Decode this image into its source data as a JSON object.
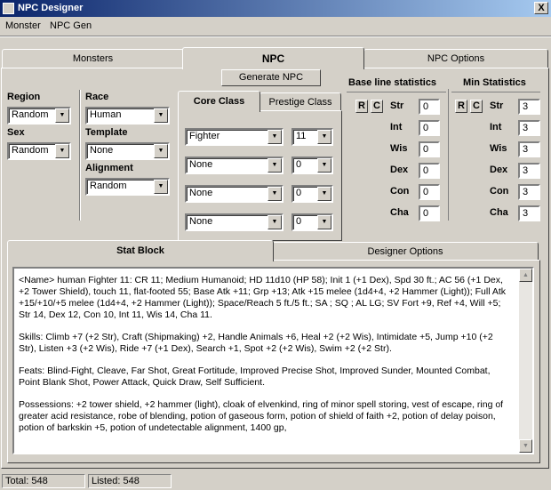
{
  "window": {
    "title": "NPC Designer",
    "close": "X"
  },
  "menu": [
    "Monster",
    "NPC Gen"
  ],
  "main_tabs": [
    "Monsters",
    "NPC",
    "NPC Options"
  ],
  "generate_button": "Generate NPC",
  "left": {
    "region_label": "Region",
    "region_value": "Random",
    "sex_label": "Sex",
    "sex_value": "Random",
    "race_label": "Race",
    "race_value": "Human",
    "template_label": "Template",
    "template_value": "None",
    "alignment_label": "Alignment",
    "alignment_value": "Random"
  },
  "class_tabs": [
    "Core Class",
    "Prestige Class"
  ],
  "classes": [
    {
      "name": "Fighter",
      "level": "11"
    },
    {
      "name": "None",
      "level": "0"
    },
    {
      "name": "None",
      "level": "0"
    },
    {
      "name": "None",
      "level": "0"
    }
  ],
  "baseline": {
    "title": "Base line statistics",
    "buttons": [
      "R",
      "C"
    ],
    "stats": [
      {
        "label": "Str",
        "value": "0"
      },
      {
        "label": "Int",
        "value": "0"
      },
      {
        "label": "Wis",
        "value": "0"
      },
      {
        "label": "Dex",
        "value": "0"
      },
      {
        "label": "Con",
        "value": "0"
      },
      {
        "label": "Cha",
        "value": "0"
      }
    ]
  },
  "minstats": {
    "title": "Min Statistics",
    "buttons": [
      "R",
      "C"
    ],
    "stats": [
      {
        "label": "Str",
        "value": "3"
      },
      {
        "label": "Int",
        "value": "3"
      },
      {
        "label": "Wis",
        "value": "3"
      },
      {
        "label": "Dex",
        "value": "3"
      },
      {
        "label": "Con",
        "value": "3"
      },
      {
        "label": "Cha",
        "value": "3"
      }
    ]
  },
  "lower_tabs": [
    "Stat Block",
    "Designer Options"
  ],
  "stat_block": [
    "<Name>  human Fighter 11: CR 11; Medium Humanoid; HD 11d10  (HP 58); Init 1 (+1 Dex), Spd 30 ft.; AC 56 (+1 Dex, +2 Tower Shield), touch 11, flat-footed 55; Base Atk +11; Grp +13; Atk +15 melee (1d4+4, +2 Hammer (Light)); Full Atk +15/+10/+5 melee (1d4+4, +2 Hammer (Light)); Space/Reach 5 ft./5 ft.; SA ; SQ ; AL LG; SV Fort +9, Ref +4, Will +5; Str 14, Dex 12, Con 10, Int 11, Wis 14, Cha 11.",
    "Skills: Climb +7 (+2 Str), Craft (Shipmaking) +2, Handle Animals +6, Heal +2 (+2 Wis), Intimidate +5, Jump +10 (+2 Str), Listen +3 (+2 Wis), Ride +7 (+1 Dex), Search +1, Spot +2 (+2 Wis), Swim +2 (+2 Str).",
    "Feats: Blind-Fight, Cleave, Far Shot, Great Fortitude, Improved Precise Shot, Improved Sunder, Mounted Combat, Point Blank Shot, Power Attack, Quick Draw, Self Sufficient.",
    "Possessions: +2 tower shield, +2 hammer (light), cloak of elvenkind, ring of minor spell storing, vest of escape, ring of greater acid resistance, robe of blending, potion of gaseous form, potion of shield of faith +2, potion of delay poison, potion of barkskin +5, potion of undetectable alignment, 1400 gp,"
  ],
  "status": {
    "total": "Total: 548",
    "listed": "Listed: 548"
  }
}
